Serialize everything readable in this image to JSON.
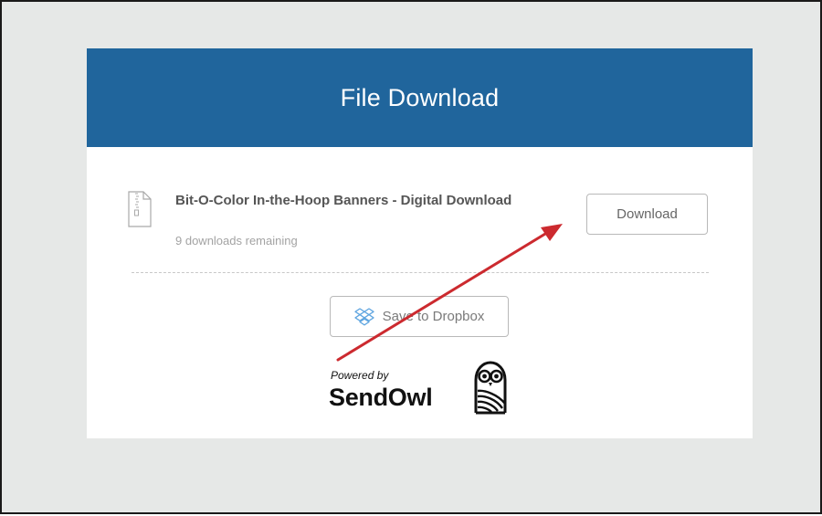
{
  "header": {
    "title": "File Download"
  },
  "file": {
    "name": "Bit-O-Color In-the-Hoop Banners - Digital Download",
    "downloads_remaining": "9 downloads remaining",
    "icon": "zip-file-icon"
  },
  "buttons": {
    "download_label": "Download",
    "dropbox_label": "Save to Dropbox",
    "dropbox_icon": "dropbox-icon"
  },
  "branding": {
    "powered_by": "Powered by",
    "brand_name": "SendOwl",
    "logo_icon": "owl-logo-icon"
  },
  "annotation": {
    "type": "arrow",
    "color": "#cc2a2f"
  },
  "colors": {
    "header_bg": "#20659c",
    "page_bg": "#e6e8e7",
    "card_bg": "#ffffff"
  }
}
